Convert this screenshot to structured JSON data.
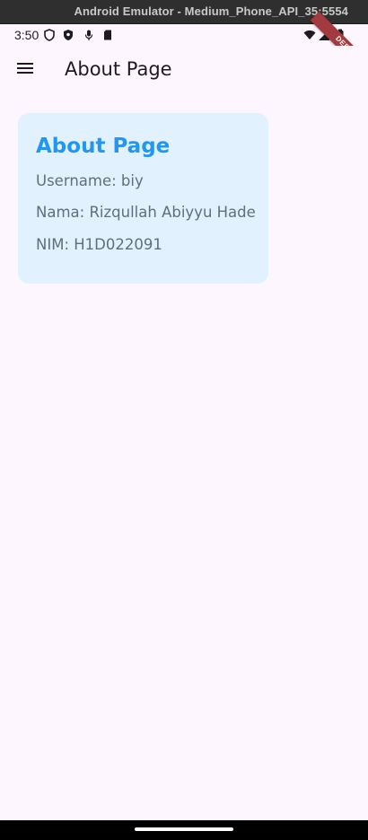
{
  "emulator": {
    "title": "Android Emulator - Medium_Phone_API_35:5554"
  },
  "status_bar": {
    "time": "3:50",
    "left_icons": [
      "shield-icon",
      "shield-filled-icon",
      "mic-icon",
      "sd-card-icon"
    ],
    "right_icons": [
      "wifi-icon",
      "signal-icon",
      "battery-icon"
    ]
  },
  "debug_banner": {
    "label": "DEBUG",
    "color": "#a23a3f"
  },
  "app_bar": {
    "menu_icon": "hamburger-menu-icon",
    "title": "About Page"
  },
  "card": {
    "title": "About Page",
    "username": "Username: biy",
    "nama": "Nama: Rizqullah Abiyyu Hade",
    "nim": "NIM: H1D022091",
    "background": "#e1f1fd",
    "title_color": "#2196f3"
  },
  "colors": {
    "page_background": "#fdf6fe",
    "text_primary": "#1d1b20",
    "text_secondary": "#5f6f7c"
  }
}
